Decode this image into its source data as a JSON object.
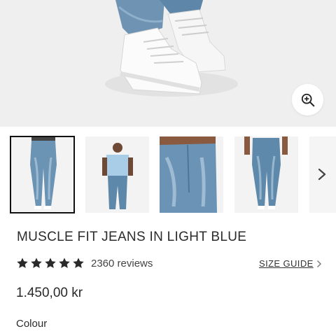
{
  "hero": {
    "image_alt": "",
    "zoom_icon": "zoom-in-icon"
  },
  "gallery": {
    "thumbnails": [
      {
        "name": "thumb-1",
        "selected": true
      },
      {
        "name": "thumb-2",
        "selected": false
      },
      {
        "name": "thumb-3",
        "selected": false
      },
      {
        "name": "thumb-4",
        "selected": false
      },
      {
        "name": "thumb-5",
        "selected": false
      }
    ],
    "next_icon": "chevron-right-icon"
  },
  "product": {
    "title": "MUSCLE FIT JEANS IN LIGHT BLUE",
    "rating": 5,
    "rating_max": 5,
    "reviews": "2360 reviews",
    "size_guide_label": "SIZE GUIDE",
    "price": "1.450,00 kr",
    "colour_label": "Colour"
  },
  "colors": {
    "denim": "#5b86a6",
    "star": "#2a2a2a",
    "hero_bg": "#efefef"
  }
}
